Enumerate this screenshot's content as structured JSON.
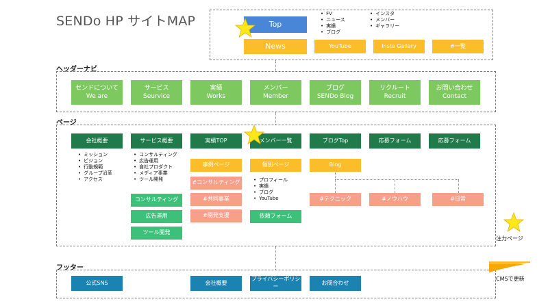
{
  "title": "SENDo HP サイトMAP",
  "top_section": {
    "top_box": "Top",
    "news_box": "News",
    "youtube_box": "YouTube",
    "insta_box": "Insta Gallary",
    "tag_box": "#一覧",
    "bullets_a": [
      "FV",
      "ニュース",
      "実績",
      "ブログ"
    ],
    "bullets_b": [
      "インスタ",
      "メンバー",
      "ギャラリー"
    ]
  },
  "header_nav": {
    "label": "ヘッダーナビ",
    "items": [
      {
        "jp": "センドについて",
        "en": "We are"
      },
      {
        "jp": "サービス",
        "en": "Seurvice"
      },
      {
        "jp": "実績",
        "en": "Works"
      },
      {
        "jp": "メンバー",
        "en": "Member"
      },
      {
        "jp": "ブログ",
        "en": "SENDo Blog"
      },
      {
        "jp": "リクルート",
        "en": "Recruit"
      },
      {
        "jp": "お問い合わせ",
        "en": "Contact"
      }
    ]
  },
  "pages": {
    "label": "ページ",
    "company": {
      "title": "会社概要",
      "bullets": [
        "ミッション",
        "ビジョン",
        "行動規範",
        "グループ沿革",
        "アクセス"
      ]
    },
    "service": {
      "title": "サービス概要",
      "bullets": [
        "コンサルティング",
        "広告運用",
        "自社プロダクト",
        "メディア事業",
        "ツール開発"
      ],
      "subpages": [
        "コンサルティング",
        "広告運用",
        "ツール開発"
      ]
    },
    "works": {
      "title": "実績TOP",
      "detail": "事例ページ",
      "tags": [
        "#コンサルティング",
        "#共同事業",
        "#開発支援"
      ]
    },
    "member": {
      "title": "メンバー一覧",
      "detail": "個別ページ",
      "bullets": [
        "プロフィール",
        "実績",
        "ブログ",
        "YouTube"
      ],
      "request": "依頼フォーム"
    },
    "blog": {
      "title": "ブログTop",
      "sub": "Blog",
      "tags": [
        "#テクニック",
        "#ノウハウ",
        "#日常"
      ]
    },
    "recruit": {
      "title": "応募フォーム"
    },
    "contact": {
      "title": "応募フォーム"
    }
  },
  "footer": {
    "label": "フッター",
    "items": [
      "公式SNS",
      "会社概要",
      "プライバシーポリシー",
      "お問合わせ"
    ]
  },
  "legend": {
    "star": "注力ページ",
    "cms": "CMSで更新"
  },
  "colors": {
    "blue": "#4a86d8",
    "yellow": "#fbbd2a",
    "light_green": "#7ec860",
    "dark_green": "#217a4a",
    "mid_green": "#3cc07a",
    "salmon": "#f6a08a",
    "teal": "#1b83b1",
    "star": "#ffe81a"
  }
}
